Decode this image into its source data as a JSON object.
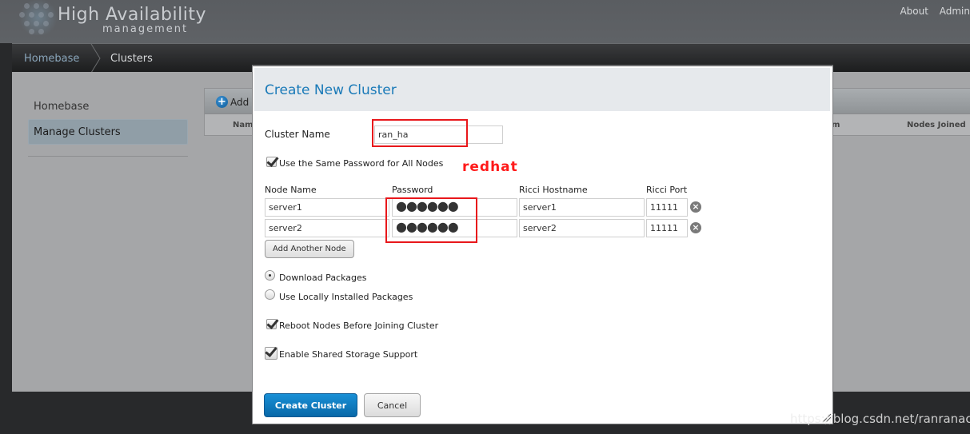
{
  "app": {
    "title": "High Availability",
    "subtitle": "management",
    "top_links": [
      "About",
      "Admin"
    ]
  },
  "breadcrumb": {
    "home": "Homebase",
    "current": "Clusters"
  },
  "sidebar": {
    "items": [
      {
        "label": "Homebase",
        "active": false
      },
      {
        "label": "Manage Clusters",
        "active": true
      }
    ]
  },
  "cluster_table": {
    "add_label": "Add",
    "columns": [
      "Name",
      "m",
      "Nodes Joined"
    ]
  },
  "modal": {
    "title": "Create New Cluster",
    "cluster_name_label": "Cluster Name",
    "cluster_name_value": "ran_ha",
    "same_password_label": "Use the Same Password for All Nodes",
    "same_password_checked": true,
    "node_columns": [
      "Node Name",
      "Password",
      "Ricci Hostname",
      "Ricci Port"
    ],
    "nodes": [
      {
        "node_name": "server1",
        "password": "●●●●●●",
        "ricci_hostname": "server1",
        "ricci_port": "11111"
      },
      {
        "node_name": "server2",
        "password": "●●●●●●",
        "ricci_hostname": "server2",
        "ricci_port": "11111"
      }
    ],
    "add_node_label": "Add Another Node",
    "package_options": [
      {
        "label": "Download Packages",
        "selected": true
      },
      {
        "label": "Use Locally Installed Packages",
        "selected": false
      }
    ],
    "reboot_label": "Reboot Nodes Before Joining Cluster",
    "reboot_checked": true,
    "shared_storage_label": "Enable Shared Storage Support",
    "shared_storage_checked": true,
    "create_label": "Create Cluster",
    "cancel_label": "Cancel"
  },
  "annotations": {
    "password_note": "redhat",
    "annotation_color": "#e8171b"
  },
  "watermark": "https://blog.csdn.net/ranranacc_",
  "colors": {
    "accent": "#1a7ab8",
    "primary_button": "#0868a8",
    "overlay": "#a5a6a8",
    "header": "#5f6266"
  }
}
